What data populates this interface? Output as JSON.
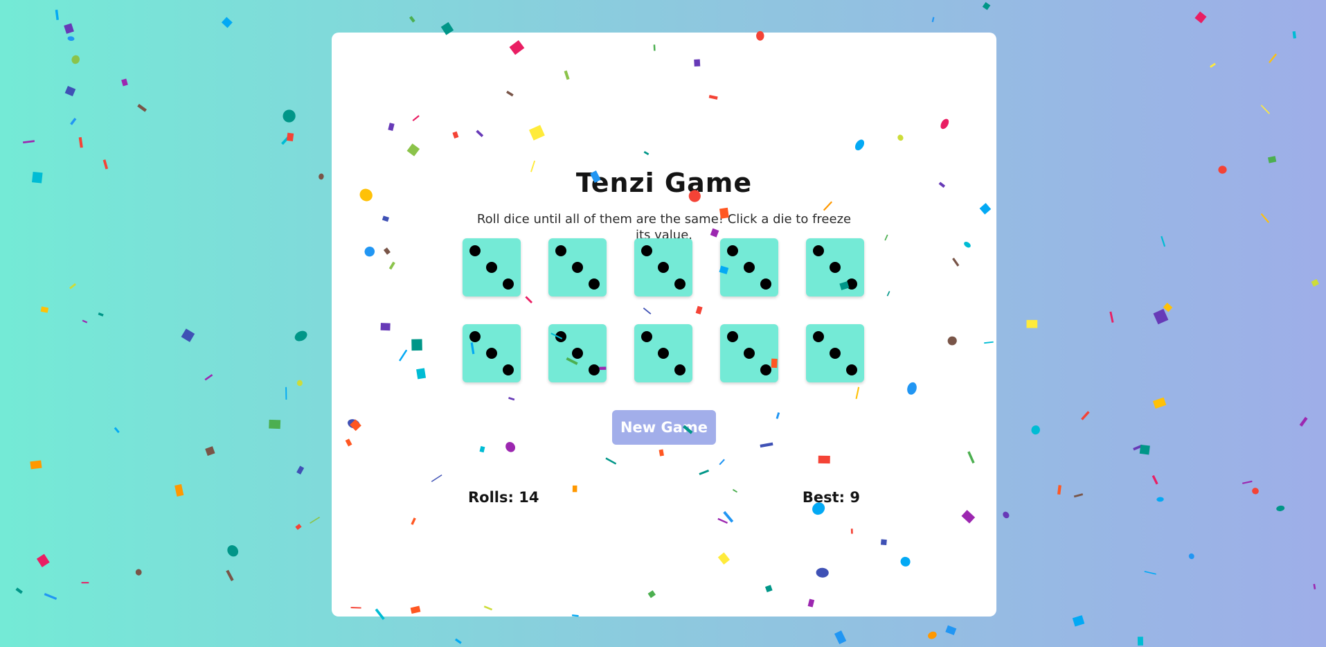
{
  "page": {
    "background_colors": [
      "#74ead6",
      "#9eaee8"
    ]
  },
  "game": {
    "title": "Tenzi Game",
    "instructions": "Roll dice until all of them are the same! Click a die to freeze its value.",
    "dice": [
      {
        "value": 3,
        "held": false
      },
      {
        "value": 3,
        "held": false
      },
      {
        "value": 3,
        "held": false
      },
      {
        "value": 3,
        "held": false
      },
      {
        "value": 3,
        "held": false
      },
      {
        "value": 3,
        "held": false
      },
      {
        "value": 3,
        "held": false
      },
      {
        "value": 3,
        "held": false
      },
      {
        "value": 3,
        "held": false
      },
      {
        "value": 3,
        "held": false
      }
    ],
    "die_color": "#74ead6",
    "new_game_label": "New Game",
    "button_color": "#a2aeea",
    "rolls_label": "Rolls: ",
    "rolls": 14,
    "best_label": "Best: ",
    "best": 9
  },
  "confetti": {
    "colors": [
      "#f44336",
      "#e91e63",
      "#9c27b0",
      "#673ab7",
      "#3f51b5",
      "#2196f3",
      "#03a9f4",
      "#00bcd4",
      "#009688",
      "#4caf50",
      "#8bc34a",
      "#cddc39",
      "#ffeb3b",
      "#ffc107",
      "#ff9800",
      "#ff5722",
      "#795548"
    ]
  }
}
